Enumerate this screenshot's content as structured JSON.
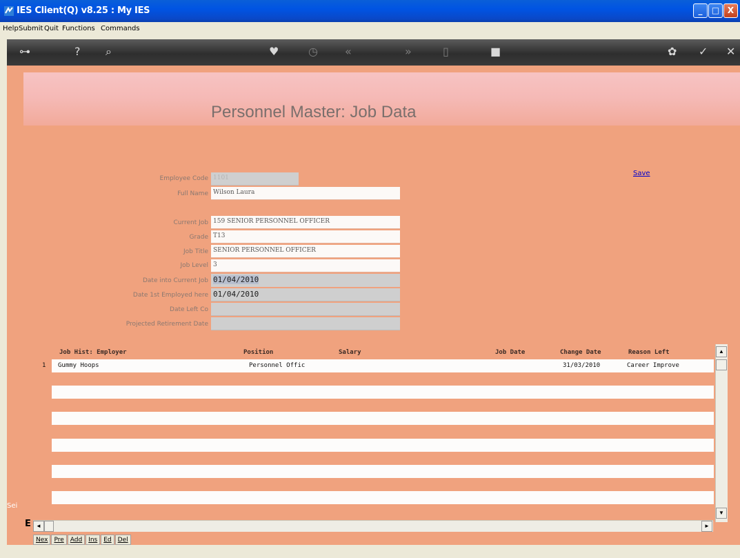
{
  "window": {
    "title": "IES Client(Q) v8.25 : My IES",
    "min_glyph": "_",
    "max_glyph": "□",
    "close_glyph": "X"
  },
  "menu": [
    "Help",
    "Submit",
    "Quit",
    "Functions",
    "Commands"
  ],
  "toolbar": {
    "icons": [
      "key-icon",
      "help-icon",
      "search-icon",
      "heart-icon",
      "clock-icon",
      "prev-icon",
      "next-icon",
      "page-icon",
      "stop-icon",
      "tools-icon",
      "ok-icon",
      "close-icon"
    ],
    "glyphs": {
      "key": "⊶",
      "help": "?",
      "search": "⌕",
      "heart": "♥",
      "clock": "◷",
      "prev": "«",
      "next": "»",
      "page": "▯",
      "stop": "■",
      "tools": "✿",
      "ok": "✓",
      "close": "✕"
    }
  },
  "page": {
    "heading": "Personnel Master: Job Data",
    "save_label": "Save"
  },
  "form": {
    "employee_code": {
      "label": "Employee Code",
      "value": "1101"
    },
    "full_name": {
      "label": "Full Name",
      "value": "Wilson Laura"
    },
    "current_job": {
      "label": "Current Job",
      "value": "159 SENIOR PERSONNEL OFFICER"
    },
    "grade": {
      "label": "Grade",
      "value": "T13"
    },
    "job_title": {
      "label": "Job Title",
      "value": "SENIOR PERSONNEL OFFICER"
    },
    "job_level": {
      "label": "Job Level",
      "value": "3"
    },
    "date_into_current_job": {
      "label": "Date into Current Job",
      "value": "01/04/2010"
    },
    "date_first_employed": {
      "label": "Date 1st Employed here",
      "value": "01/04/2010"
    },
    "date_left": {
      "label": "Date Left Co",
      "value": ""
    },
    "projected_retirement": {
      "label": "Projected Retirement Date",
      "value": ""
    }
  },
  "grid": {
    "headers": [
      "Job Hist: Employer",
      "Position",
      "Salary",
      "Job Date",
      "Change Date",
      "Reason Left"
    ],
    "rows": [
      {
        "num": "1",
        "employer": "Gummy Hoops",
        "position": "Personnel Offic",
        "salary": "",
        "job_date": "",
        "change_date": "31/03/2010",
        "reason_left": "Career Improve"
      }
    ]
  },
  "nav_buttons": [
    "Nex",
    "Pre",
    "Add",
    "Ins",
    "Ed",
    "Del"
  ],
  "side": {
    "sei": "Sei",
    "e": "E"
  }
}
